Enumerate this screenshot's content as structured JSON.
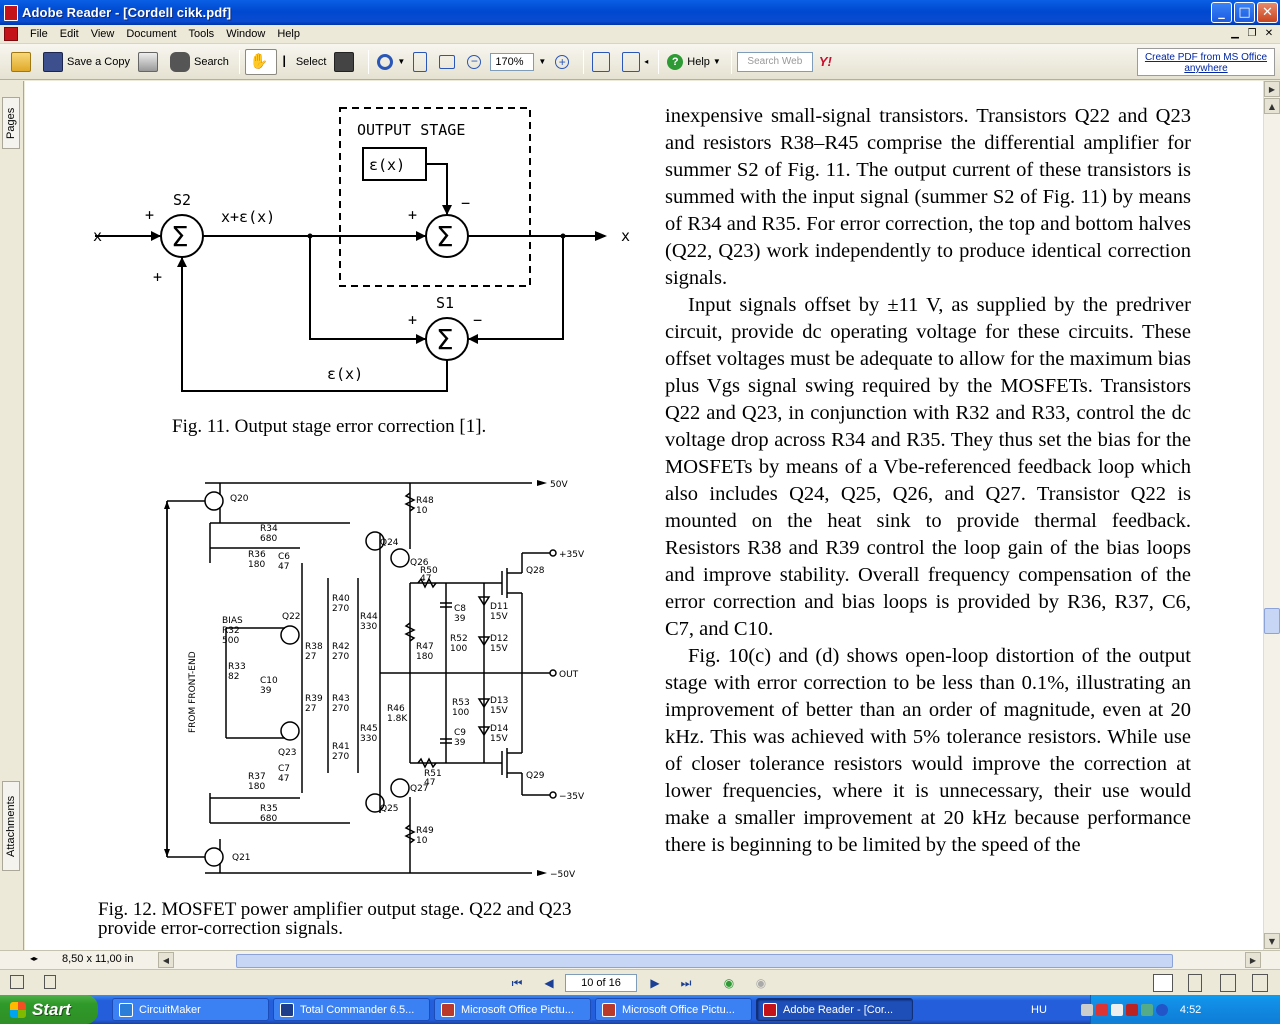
{
  "window": {
    "title": "Adobe Reader - [Cordell cikk.pdf]",
    "buttons": {
      "minimize": "_",
      "maximize": "□",
      "close": "✕"
    }
  },
  "menu": [
    "File",
    "Edit",
    "View",
    "Document",
    "Tools",
    "Window",
    "Help"
  ],
  "toolbar": {
    "save_copy": "Save a Copy",
    "search": "Search",
    "select": "Select",
    "zoom": "170%",
    "help": "Help",
    "search_web_placeholder": "Search Web",
    "create_pdf_line1": "Create PDF from MS Office",
    "create_pdf_line2": "anywhere"
  },
  "side_tabs": {
    "pages": "Pages",
    "attachments": "Attachments"
  },
  "document": {
    "fig11": {
      "caption": "Fig. 11.  Output stage error correction [1].",
      "labels": {
        "output_stage": "OUTPUT STAGE",
        "eps_box": "ε(x)",
        "s2": "S2",
        "s1": "S1",
        "x_in": "x",
        "x_out": "x",
        "signal": "x+ε(x)",
        "eps_feedback": "ε(x)",
        "plus": "+",
        "minus": "−",
        "sigma": "Σ"
      }
    },
    "fig12": {
      "caption_line1": "Fig. 12.  MOSFET power amplifier output stage. Q22 and Q23",
      "caption_line2": "provide error-correction signals.",
      "labels": {
        "p50": "50V",
        "p35": "+35V",
        "out": "OUT",
        "m35": "−35V",
        "m50": "−50V",
        "from_front_end": "FROM FRONT-END",
        "bias": "BIAS",
        "q20": "Q20",
        "q21": "Q21",
        "q22": "Q22",
        "q23": "Q23",
        "q24": "Q24",
        "q25": "Q25",
        "q26": "Q26",
        "q27": "Q27",
        "q28": "Q28",
        "q29": "Q29",
        "r34": "R34",
        "r34v": "680",
        "r35": "R35",
        "r35v": "680",
        "r36": "R36",
        "r36v": "180",
        "c6": "C6",
        "c6v": "47",
        "r37": "R37",
        "r37v": "180",
        "c7": "C7",
        "c7v": "47",
        "r32": "R32",
        "r32v": "500",
        "r33": "R33",
        "r33v": "82",
        "c10": "C10",
        "c10v": "39",
        "r38": "R38",
        "r38v": "27",
        "r39": "R39",
        "r39v": "27",
        "r40": "R40",
        "r40v": "270",
        "r41": "R41",
        "r41v": "270",
        "r42": "R42",
        "r42v": "270",
        "r43": "R43",
        "r43v": "270",
        "r44": "R44",
        "r44v": "330",
        "r45": "R45",
        "r45v": "330",
        "r46": "R46",
        "r46v": "1.8K",
        "r48": "R48",
        "r48v": "10",
        "r49": "R49",
        "r49v": "10",
        "r50": "R50",
        "r50v": "47",
        "r51": "R51",
        "r51v": "47",
        "r47": "R47",
        "r47v": "180",
        "c8": "C8",
        "c8v": "39",
        "c9": "C9",
        "c9v": "39",
        "r52": "R52",
        "r52v": "100",
        "r53": "R53",
        "r53v": "100",
        "d11": "D11",
        "d11v": "15V",
        "d12": "D12",
        "d12v": "15V",
        "d13": "D13",
        "d13v": "15V",
        "d14": "D14",
        "d14v": "15V"
      }
    },
    "paragraphs": [
      "inexpensive small-signal transistors. Transistors Q22 and Q23 and resistors R38–R45 comprise the differential amplifier for summer S2 of Fig. 11. The output current of these transistors is summed with the input signal (summer S2 of Fig. 11) by means of R34 and R35. For error correction, the top and bottom halves (Q22, Q23) work independently to produce identical correction signals.",
      "Input signals offset by ±11 V, as supplied by the predriver circuit, provide dc operating voltage for these circuits. These offset voltages must be adequate to allow for the maximum bias plus Vgs signal swing required by the MOSFETs. Transistors Q22 and Q23, in conjunction with R32 and R33, control the dc voltage drop across R34 and R35. They thus set the bias for the MOSFETs by means of a Vbe-referenced feedback loop which also includes Q24, Q25, Q26, and Q27. Transistor Q22 is mounted on the heat sink to provide thermal feedback. Resistors R38 and R39 control the loop gain of the bias loops and improve stability. Overall frequency compensation of the error correction and bias loops is provided by R36, R37, C6, C7, and C10.",
      "Fig. 10(c) and (d) shows open-loop distortion of the output stage with error correction to be less than 0.1%, illustrating an improvement of better than an order of magnitude, even at 20 kHz. This was achieved with 5% tolerance resistors. While use of closer tolerance resistors would improve the correction at lower frequencies, where it is unnecessary, their use would make a smaller improvement at 20 kHz because performance there is beginning to be limited by the speed of the"
    ]
  },
  "status": {
    "page_size": "8,50 x 11,00 in",
    "page_indicator": "10 of 16"
  },
  "taskbar": {
    "start": "Start",
    "tasks": [
      "CircuitMaker",
      "Total Commander 6.5...",
      "Microsoft Office Pictu...",
      "Microsoft Office Pictu...",
      "Adobe Reader - [Cor..."
    ],
    "language": "HU",
    "clock": "4:52"
  }
}
